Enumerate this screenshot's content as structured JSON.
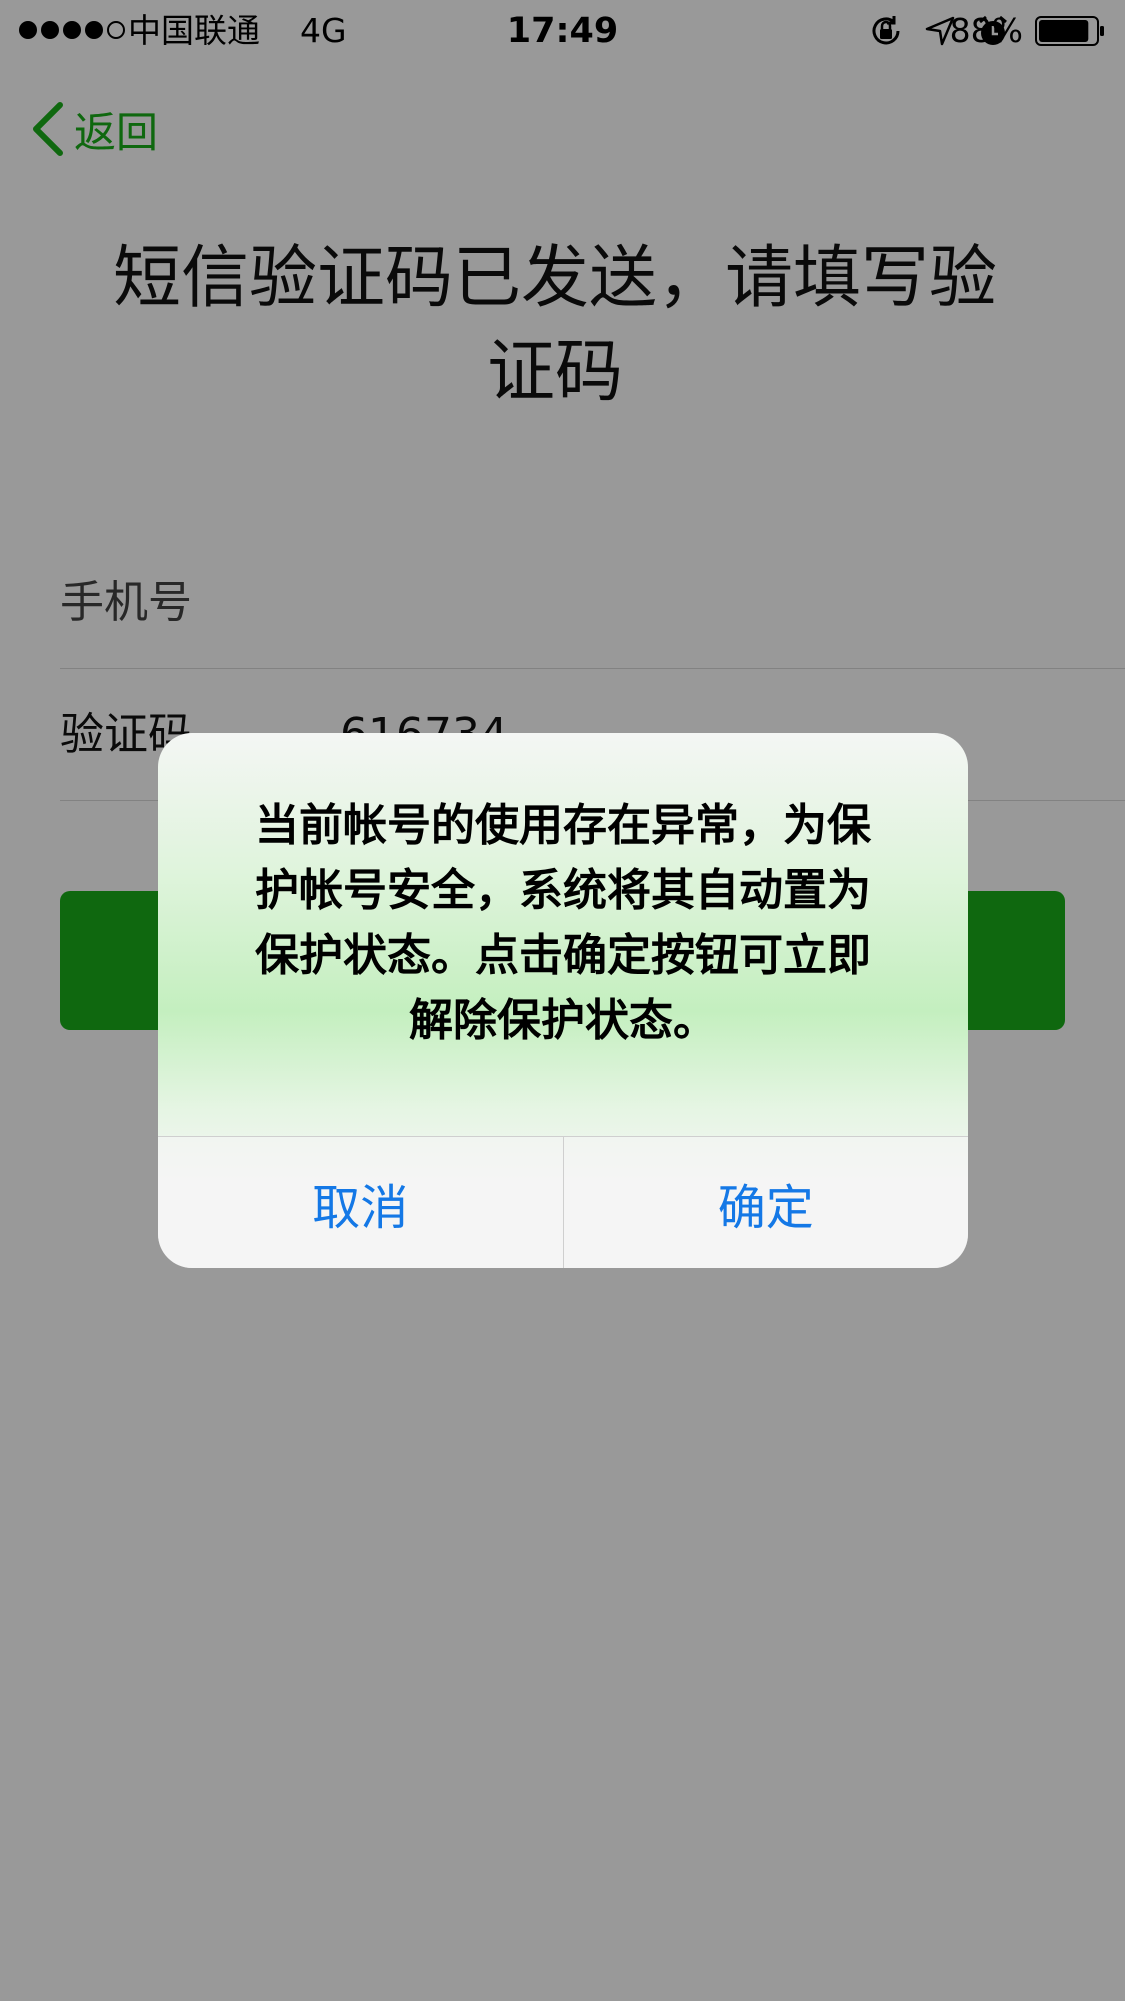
{
  "status_bar": {
    "carrier": "中国联通",
    "network": "4G",
    "time": "17:49",
    "battery_percent": "88%",
    "signal_bars": 4,
    "signal_max": 5,
    "battery_level": 0.88,
    "icons": [
      "orientation-lock-icon",
      "location-arrow-icon",
      "alarm-icon"
    ]
  },
  "nav": {
    "back_label": "返回",
    "accent_color": "#1aad19"
  },
  "title": {
    "line1": "短信验证码已发送，请填写验",
    "line2": "证码"
  },
  "form": {
    "phone_label": "手机号",
    "code_label": "验证码",
    "code_value": "616734"
  },
  "alert": {
    "message_lines": [
      "当前帐号的使用存在异常，为保",
      "护帐号安全，系统将其自动置为",
      "保护状态。点击确定按钮可立即",
      "解除保护状态。"
    ],
    "cancel_label": "取消",
    "confirm_label": "确定",
    "button_color": "#1478e6"
  }
}
